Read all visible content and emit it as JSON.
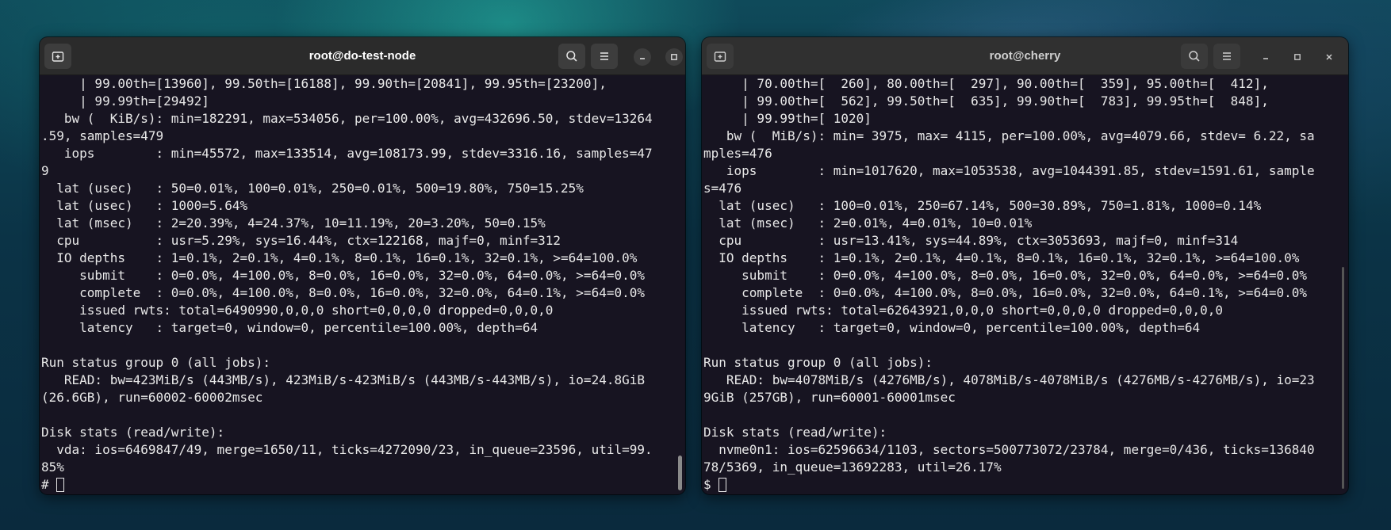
{
  "left_window": {
    "title": "root@do-test-node",
    "lines": [
      "     | 99.00th=[13960], 99.50th=[16188], 99.90th=[20841], 99.95th=[23200],",
      "     | 99.99th=[29492]",
      "   bw (  KiB/s): min=182291, max=534056, per=100.00%, avg=432696.50, stdev=13264",
      ".59, samples=479",
      "   iops        : min=45572, max=133514, avg=108173.99, stdev=3316.16, samples=47",
      "9",
      "  lat (usec)   : 50=0.01%, 100=0.01%, 250=0.01%, 500=19.80%, 750=15.25%",
      "  lat (usec)   : 1000=5.64%",
      "  lat (msec)   : 2=20.39%, 4=24.37%, 10=11.19%, 20=3.20%, 50=0.15%",
      "  cpu          : usr=5.29%, sys=16.44%, ctx=122168, majf=0, minf=312",
      "  IO depths    : 1=0.1%, 2=0.1%, 4=0.1%, 8=0.1%, 16=0.1%, 32=0.1%, >=64=100.0%",
      "     submit    : 0=0.0%, 4=100.0%, 8=0.0%, 16=0.0%, 32=0.0%, 64=0.0%, >=64=0.0%",
      "     complete  : 0=0.0%, 4=100.0%, 8=0.0%, 16=0.0%, 32=0.0%, 64=0.1%, >=64=0.0%",
      "     issued rwts: total=6490990,0,0,0 short=0,0,0,0 dropped=0,0,0,0",
      "     latency   : target=0, window=0, percentile=100.00%, depth=64",
      "",
      "Run status group 0 (all jobs):",
      "   READ: bw=423MiB/s (443MB/s), 423MiB/s-423MiB/s (443MB/s-443MB/s), io=24.8GiB",
      "(26.6GB), run=60002-60002msec",
      "",
      "Disk stats (read/write):",
      "  vda: ios=6469847/49, merge=1650/11, ticks=4272090/23, in_queue=23596, util=99.",
      "85%"
    ],
    "prompt": "# "
  },
  "right_window": {
    "title": "root@cherry",
    "lines": [
      "     | 70.00th=[  260], 80.00th=[  297], 90.00th=[  359], 95.00th=[  412],",
      "     | 99.00th=[  562], 99.50th=[  635], 99.90th=[  783], 99.95th=[  848],",
      "     | 99.99th=[ 1020]",
      "   bw (  MiB/s): min= 3975, max= 4115, per=100.00%, avg=4079.66, stdev= 6.22, sa",
      "mples=476",
      "   iops        : min=1017620, max=1053538, avg=1044391.85, stdev=1591.61, sample",
      "s=476",
      "  lat (usec)   : 100=0.01%, 250=67.14%, 500=30.89%, 750=1.81%, 1000=0.14%",
      "  lat (msec)   : 2=0.01%, 4=0.01%, 10=0.01%",
      "  cpu          : usr=13.41%, sys=44.89%, ctx=3053693, majf=0, minf=314",
      "  IO depths    : 1=0.1%, 2=0.1%, 4=0.1%, 8=0.1%, 16=0.1%, 32=0.1%, >=64=100.0%",
      "     submit    : 0=0.0%, 4=100.0%, 8=0.0%, 16=0.0%, 32=0.0%, 64=0.0%, >=64=0.0%",
      "     complete  : 0=0.0%, 4=100.0%, 8=0.0%, 16=0.0%, 32=0.0%, 64=0.1%, >=64=0.0%",
      "     issued rwts: total=62643921,0,0,0 short=0,0,0,0 dropped=0,0,0,0",
      "     latency   : target=0, window=0, percentile=100.00%, depth=64",
      "",
      "Run status group 0 (all jobs):",
      "   READ: bw=4078MiB/s (4276MB/s), 4078MiB/s-4078MiB/s (4276MB/s-4276MB/s), io=23",
      "9GiB (257GB), run=60001-60001msec",
      "",
      "Disk stats (read/write):",
      "  nvme0n1: ios=62596634/1103, sectors=500773072/23784, merge=0/436, ticks=136840",
      "78/5369, in_queue=13692283, util=26.17%"
    ],
    "prompt": "$ "
  },
  "icons": {
    "new_tab": "new-tab-icon",
    "search": "search-icon",
    "menu": "hamburger-menu-icon",
    "minimize": "minimize-icon",
    "maximize": "maximize-icon",
    "close": "close-icon"
  }
}
